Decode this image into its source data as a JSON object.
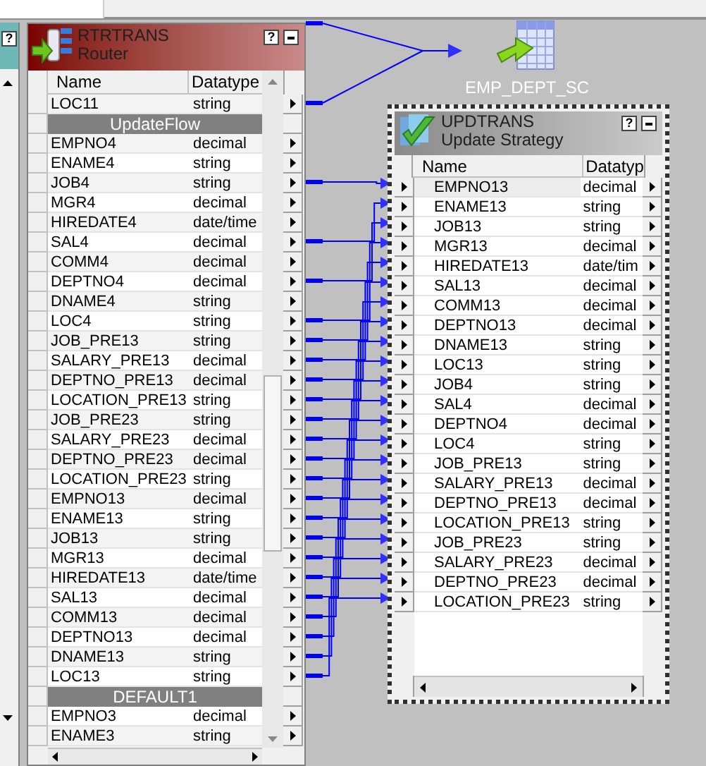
{
  "left_panel": {
    "help": "?"
  },
  "router": {
    "name": "RTRTRANS",
    "type": "Router",
    "help": "?",
    "columns": [
      "Name",
      "Datatype"
    ],
    "rows": [
      {
        "kind": "port",
        "name": "LOC11",
        "datatype": "string",
        "connected": true
      },
      {
        "kind": "group",
        "name": "UpdateFlow"
      },
      {
        "kind": "port",
        "name": "EMPNO4",
        "datatype": "decimal",
        "connected": false
      },
      {
        "kind": "port",
        "name": "ENAME4",
        "datatype": "string",
        "connected": false
      },
      {
        "kind": "port",
        "name": "JOB4",
        "datatype": "string",
        "connected": true
      },
      {
        "kind": "port",
        "name": "MGR4",
        "datatype": "decimal",
        "connected": false
      },
      {
        "kind": "port",
        "name": "HIREDATE4",
        "datatype": "date/time",
        "connected": false
      },
      {
        "kind": "port",
        "name": "SAL4",
        "datatype": "decimal",
        "connected": true
      },
      {
        "kind": "port",
        "name": "COMM4",
        "datatype": "decimal",
        "connected": false
      },
      {
        "kind": "port",
        "name": "DEPTNO4",
        "datatype": "decimal",
        "connected": true
      },
      {
        "kind": "port",
        "name": "DNAME4",
        "datatype": "string",
        "connected": false
      },
      {
        "kind": "port",
        "name": "LOC4",
        "datatype": "string",
        "connected": true
      },
      {
        "kind": "port",
        "name": "JOB_PRE13",
        "datatype": "string",
        "connected": true
      },
      {
        "kind": "port",
        "name": "SALARY_PRE13",
        "datatype": "decimal",
        "connected": true
      },
      {
        "kind": "port",
        "name": "DEPTNO_PRE13",
        "datatype": "decimal",
        "connected": true
      },
      {
        "kind": "port",
        "name": "LOCATION_PRE13",
        "datatype": "string",
        "connected": true
      },
      {
        "kind": "port",
        "name": "JOB_PRE23",
        "datatype": "string",
        "connected": true
      },
      {
        "kind": "port",
        "name": "SALARY_PRE23",
        "datatype": "decimal",
        "connected": true
      },
      {
        "kind": "port",
        "name": "DEPTNO_PRE23",
        "datatype": "decimal",
        "connected": true
      },
      {
        "kind": "port",
        "name": "LOCATION_PRE23",
        "datatype": "string",
        "connected": true
      },
      {
        "kind": "port",
        "name": "EMPNO13",
        "datatype": "decimal",
        "connected": true
      },
      {
        "kind": "port",
        "name": "ENAME13",
        "datatype": "string",
        "connected": true
      },
      {
        "kind": "port",
        "name": "JOB13",
        "datatype": "string",
        "connected": true
      },
      {
        "kind": "port",
        "name": "MGR13",
        "datatype": "decimal",
        "connected": true
      },
      {
        "kind": "port",
        "name": "HIREDATE13",
        "datatype": "date/time",
        "connected": true
      },
      {
        "kind": "port",
        "name": "SAL13",
        "datatype": "decimal",
        "connected": true
      },
      {
        "kind": "port",
        "name": "COMM13",
        "datatype": "decimal",
        "connected": true
      },
      {
        "kind": "port",
        "name": "DEPTNO13",
        "datatype": "decimal",
        "connected": true
      },
      {
        "kind": "port",
        "name": "DNAME13",
        "datatype": "string",
        "connected": true
      },
      {
        "kind": "port",
        "name": "LOC13",
        "datatype": "string",
        "connected": true
      },
      {
        "kind": "group",
        "name": "DEFAULT1"
      },
      {
        "kind": "port",
        "name": "EMPNO3",
        "datatype": "decimal",
        "connected": false
      },
      {
        "kind": "port",
        "name": "ENAME3",
        "datatype": "string",
        "connected": false
      }
    ]
  },
  "target": {
    "name": "EMP_DEPT_SC"
  },
  "update": {
    "name": "UPDTRANS",
    "type": "Update Strategy",
    "help": "?",
    "selected": true,
    "columns": [
      "Name",
      "Datatyp"
    ],
    "rows": [
      {
        "name": "EMPNO13",
        "datatype": "decimal"
      },
      {
        "name": "ENAME13",
        "datatype": "string"
      },
      {
        "name": "JOB13",
        "datatype": "string"
      },
      {
        "name": "MGR13",
        "datatype": "decimal"
      },
      {
        "name": "HIREDATE13",
        "datatype": "date/tim"
      },
      {
        "name": "SAL13",
        "datatype": "decimal"
      },
      {
        "name": "COMM13",
        "datatype": "decimal"
      },
      {
        "name": "DEPTNO13",
        "datatype": "decimal"
      },
      {
        "name": "DNAME13",
        "datatype": "string"
      },
      {
        "name": "LOC13",
        "datatype": "string"
      },
      {
        "name": "JOB4",
        "datatype": "string"
      },
      {
        "name": "SAL4",
        "datatype": "decimal"
      },
      {
        "name": "DEPTNO4",
        "datatype": "decimal"
      },
      {
        "name": "LOC4",
        "datatype": "string"
      },
      {
        "name": "JOB_PRE13",
        "datatype": "string"
      },
      {
        "name": "SALARY_PRE13",
        "datatype": "decimal"
      },
      {
        "name": "DEPTNO_PRE13",
        "datatype": "decimal"
      },
      {
        "name": "LOCATION_PRE13",
        "datatype": "string"
      },
      {
        "name": "JOB_PRE23",
        "datatype": "string"
      },
      {
        "name": "SALARY_PRE23",
        "datatype": "decimal"
      },
      {
        "name": "DEPTNO_PRE23",
        "datatype": "decimal"
      },
      {
        "name": "LOCATION_PRE23",
        "datatype": "string"
      }
    ]
  }
}
